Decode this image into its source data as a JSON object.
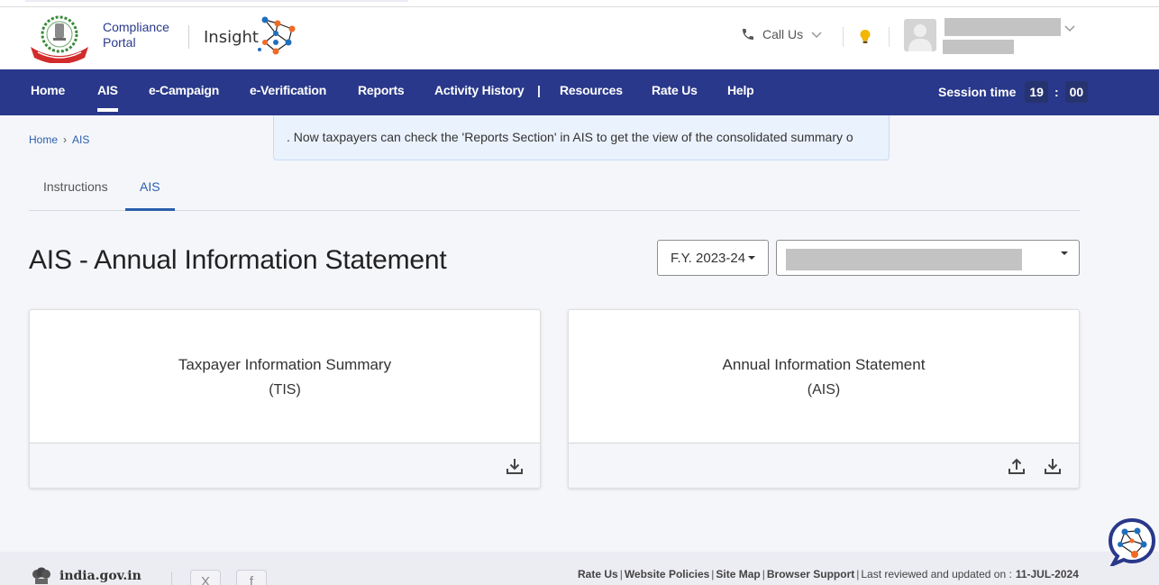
{
  "header": {
    "brand_line1": "Compliance",
    "brand_line2": "Portal",
    "insight_label": "Insight",
    "call_us": "Call Us",
    "icons": {
      "emblem": "income-tax-department-emblem",
      "insight": "insight-network-icon",
      "phone": "phone-icon",
      "call_chevron": "chevron-down-icon",
      "bulb": "lightbulb-icon",
      "avatar": "user-avatar-icon",
      "user_chevron": "chevron-down-icon"
    }
  },
  "nav": {
    "items": [
      {
        "label": "Home",
        "active": false
      },
      {
        "label": "AIS",
        "active": true
      },
      {
        "label": "e-Campaign",
        "active": false
      },
      {
        "label": "e-Verification",
        "active": false
      },
      {
        "label": "Reports",
        "active": false
      },
      {
        "label": "Activity History",
        "active": false
      },
      {
        "label": "Resources",
        "active": false
      },
      {
        "label": "Rate Us",
        "active": false
      },
      {
        "label": "Help",
        "active": false
      }
    ],
    "separator": "|",
    "session_label": "Session time",
    "session_minutes": "19",
    "session_colon": ":",
    "session_seconds": "00"
  },
  "breadcrumb": {
    "items": [
      "Home",
      "AIS"
    ],
    "separator": "›"
  },
  "notice": {
    "text": ". Now taxpayers can check the 'Reports Section' in AIS to get the view of the consolidated summary o"
  },
  "tabs": [
    {
      "label": "Instructions",
      "active": false
    },
    {
      "label": "AIS",
      "active": true
    }
  ],
  "page": {
    "title": "AIS - Annual Information Statement",
    "fy_select": "F.Y. 2023-24"
  },
  "cards": [
    {
      "title": "Taxpayer Information Summary",
      "abbr": "(TIS)",
      "actions": [
        "download"
      ]
    },
    {
      "title": "Annual Information Statement",
      "abbr": "(AIS)",
      "actions": [
        "upload",
        "download"
      ]
    }
  ],
  "footer": {
    "gov_label": "india.gov.in",
    "social": [
      "X",
      "f"
    ],
    "links": [
      "Rate Us",
      "Website Policies",
      "Site Map",
      "Browser Support"
    ],
    "last_reviewed_label": "Last reviewed and updated on :",
    "last_reviewed_date": "11-JUL-2024"
  },
  "colors": {
    "nav_bg": "#29388a",
    "brand_blue": "#2a3a8c",
    "link_blue": "#2a5fad",
    "notice_bg": "#eaf2fd",
    "page_bg": "#f5f6fa",
    "bulb": "#f2b600"
  }
}
